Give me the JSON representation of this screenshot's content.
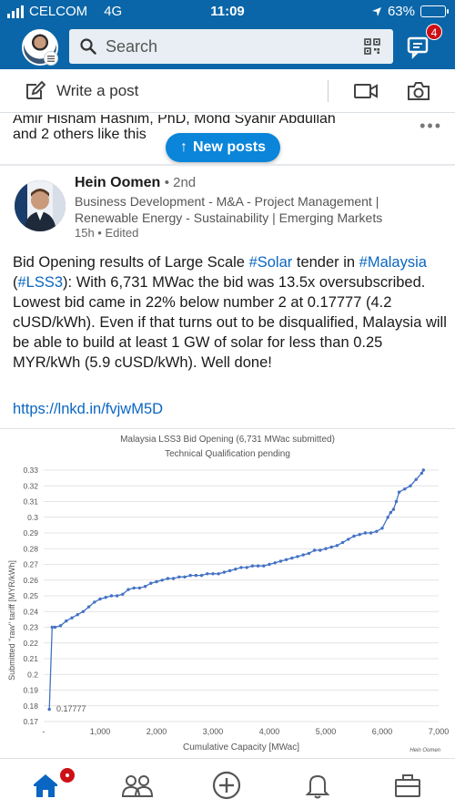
{
  "status": {
    "carrier": "CELCOM",
    "network": "4G",
    "time": "11:09",
    "battery": "63%",
    "battery_level": 0.63
  },
  "appbar": {
    "search_placeholder": "Search",
    "messages_badge": "4"
  },
  "postbar": {
    "write_label": "Write a post"
  },
  "feed": {
    "likes_line1": "Amir Hisham Hashim, PhD, Mohd Syahir Abdullah",
    "likes_line2": "and 2 others like this",
    "new_posts_label": "New posts",
    "new_posts_arrow": "↑"
  },
  "post": {
    "author_name": "Hein Oomen",
    "author_degree": "• 2nd",
    "author_title": "Business Development - M&A - Project Management | Renewable Energy - Sustainability | Emerging Markets",
    "time": "15h • Edited",
    "text_parts": {
      "p1": "Bid Opening results of Large Scale ",
      "tag1": "#Solar",
      "p2": " tender in ",
      "tag2": "#Malaysia",
      "p3": " (",
      "tag3": "#LSS3",
      "p4": "): With 6,731 MWac the bid was 13.5x oversubscribed. Lowest bid came in 22% below number 2 at 0.17777 (4.2 cUSD/kWh). Even if that turns out to be disqualified, Malaysia will be able to build at least 1 GW of solar for less than 0.25 MYR/kWh (5.9 cUSD/kWh). Well done!"
    },
    "link": "https://lnkd.in/fvjwM5D"
  },
  "chart_data": {
    "type": "line",
    "title": "Malaysia LSS3 Bid Opening (6,731 MWac submitted)",
    "subtitle": "Technical Qualification pending",
    "xlabel": "Cumulative Capacity [MWac]",
    "ylabel": "Submitted \"raw\" tariff [MYR/kWh]",
    "credit": "Hein Oomen",
    "annotation": "0.17777",
    "xlim": [
      0,
      7000
    ],
    "ylim": [
      0.17,
      0.33
    ],
    "xticks": [
      "-",
      "1,000",
      "2,000",
      "3,000",
      "4,000",
      "5,000",
      "6,000",
      "7,000"
    ],
    "yticks": [
      "0.17",
      "0.18",
      "0.19",
      "0.2",
      "0.21",
      "0.22",
      "0.23",
      "0.24",
      "0.25",
      "0.26",
      "0.27",
      "0.28",
      "0.29",
      "0.3",
      "0.31",
      "0.32",
      "0.33"
    ],
    "grid": "horizontal",
    "color": "#4472c4",
    "x": [
      100,
      150,
      200,
      300,
      400,
      500,
      600,
      700,
      800,
      900,
      1000,
      1100,
      1200,
      1300,
      1400,
      1500,
      1600,
      1700,
      1800,
      1900,
      2000,
      2100,
      2200,
      2300,
      2400,
      2500,
      2600,
      2700,
      2800,
      2900,
      3000,
      3100,
      3200,
      3300,
      3400,
      3500,
      3600,
      3700,
      3800,
      3900,
      4000,
      4100,
      4200,
      4300,
      4400,
      4500,
      4600,
      4700,
      4800,
      4900,
      5000,
      5100,
      5200,
      5300,
      5400,
      5500,
      5600,
      5700,
      5800,
      5900,
      6000,
      6100,
      6150,
      6200,
      6250,
      6300,
      6400,
      6500,
      6600,
      6700,
      6731
    ],
    "y": [
      0.17777,
      0.23,
      0.23,
      0.231,
      0.234,
      0.236,
      0.238,
      0.24,
      0.243,
      0.246,
      0.248,
      0.249,
      0.25,
      0.25,
      0.251,
      0.254,
      0.255,
      0.255,
      0.256,
      0.258,
      0.259,
      0.26,
      0.261,
      0.261,
      0.262,
      0.262,
      0.263,
      0.263,
      0.263,
      0.264,
      0.264,
      0.264,
      0.265,
      0.266,
      0.267,
      0.268,
      0.268,
      0.269,
      0.269,
      0.269,
      0.27,
      0.271,
      0.272,
      0.273,
      0.274,
      0.275,
      0.276,
      0.277,
      0.279,
      0.279,
      0.28,
      0.281,
      0.282,
      0.284,
      0.286,
      0.288,
      0.289,
      0.29,
      0.29,
      0.291,
      0.293,
      0.3,
      0.303,
      0.305,
      0.31,
      0.316,
      0.318,
      0.32,
      0.324,
      0.328,
      0.33
    ]
  }
}
